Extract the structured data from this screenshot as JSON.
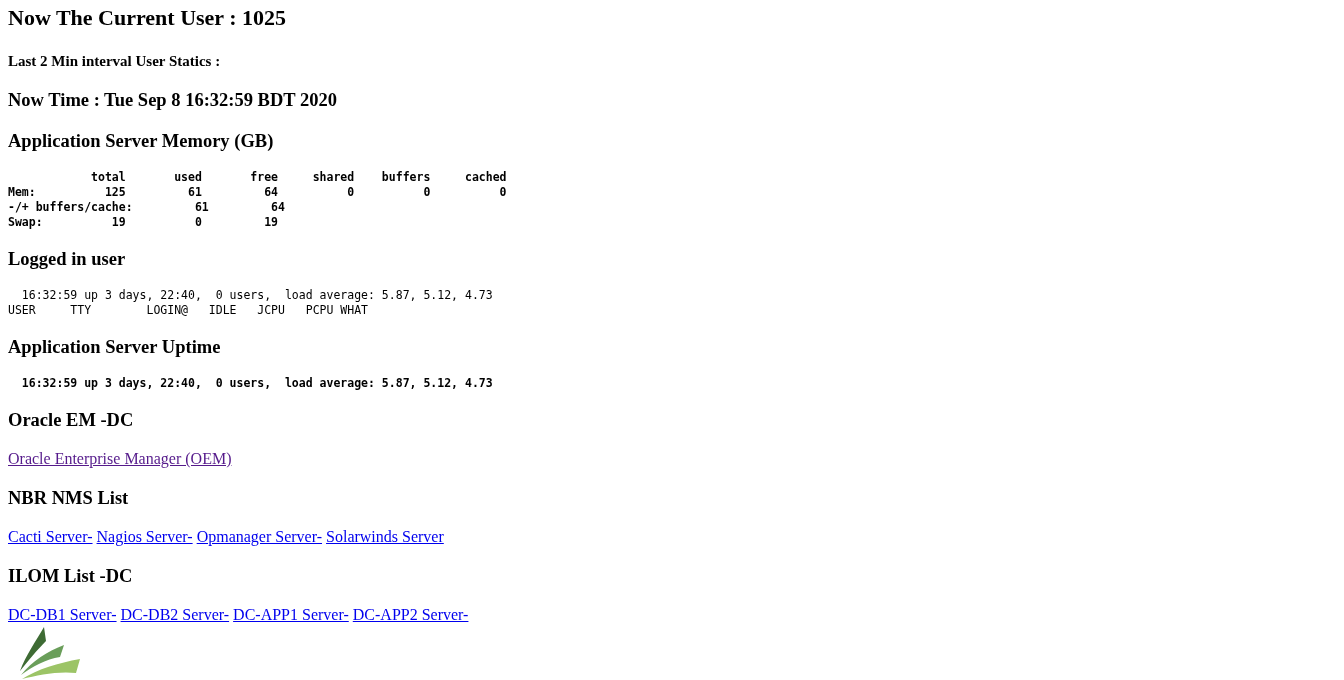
{
  "title": "Now The Current User : 1025",
  "subtitle": "Last 2 Min interval User Statics :",
  "now_time": "Now Time : Tue Sep 8 16:32:59 BDT 2020",
  "sections": [
    {
      "heading": "Application Server Memory (GB)",
      "kind": "pre",
      "bold": true,
      "lines": [
        "            total       used       free     shared    buffers     cached",
        "Mem:          125         61         64          0          0          0",
        "-/+ buffers/cache:         61         64",
        "Swap:          19          0         19"
      ]
    },
    {
      "heading": "Logged in user",
      "kind": "pre",
      "bold": false,
      "lines": [
        "  16:32:59 up 3 days, 22:40,  0 users,  load average: 5.87, 5.12, 4.73",
        "USER     TTY        LOGIN@   IDLE   JCPU   PCPU WHAT"
      ]
    },
    {
      "heading": "Application Server Uptime",
      "kind": "pre",
      "bold": true,
      "lines": [
        "  16:32:59 up 3 days, 22:40,  0 users,  load average: 5.87, 5.12, 4.73"
      ]
    },
    {
      "heading": "Oracle EM -DC",
      "kind": "links",
      "links": [
        {
          "text": "Oracle Enterprise Manager (OEM)",
          "visited": true
        }
      ]
    },
    {
      "heading": "NBR NMS List",
      "kind": "links",
      "links": [
        {
          "text": "Cacti Server-",
          "visited": false
        },
        {
          "text": "Nagios Server-",
          "visited": false
        },
        {
          "text": "Opmanager Server-",
          "visited": false
        },
        {
          "text": "Solarwinds Server",
          "visited": false
        }
      ]
    },
    {
      "heading": "ILOM List -DC",
      "kind": "links",
      "links": [
        {
          "text": "DC-DB1 Server-",
          "visited": false
        },
        {
          "text": "DC-DB2 Server-",
          "visited": false
        },
        {
          "text": "DC-APP1 Server-",
          "visited": false
        },
        {
          "text": "DC-APP2 Server-",
          "visited": false
        }
      ]
    }
  ]
}
